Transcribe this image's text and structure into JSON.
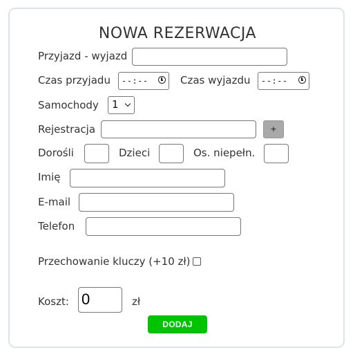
{
  "form": {
    "title": "NOWA REZERWACJA",
    "stay_label": "Przyjazd - wyjazd",
    "arrival_time_label": "Czas przyjadu",
    "arrival_time_value": "--:--",
    "departure_time_label": "Czas wyjazdu",
    "departure_time_value": "--:--",
    "cars_label": "Samochody",
    "cars_selected": "1",
    "registration_label": "Rejestracja",
    "add_plate_label": "+",
    "adults_label": "Dorośli",
    "children_label": "Dzieci",
    "disabled_label": "Os. niepełn.",
    "name_label": "Imię",
    "email_label": "E-mail",
    "phone_label": "Telefon",
    "key_storage_label": "Przechowanie kluczy (+10 zł)",
    "cost_label": "Koszt:",
    "cost_value": "0",
    "currency": "zł",
    "submit_label": "DODAJ"
  },
  "colors": {
    "submit_bg": "#00c400",
    "plus_bg": "#a9a9a9",
    "card_border": "#dde3ec"
  },
  "icons": {
    "time_picker": "clock-icon",
    "select": "chevron-down-icon",
    "checkbox": "checkbox-icon"
  }
}
